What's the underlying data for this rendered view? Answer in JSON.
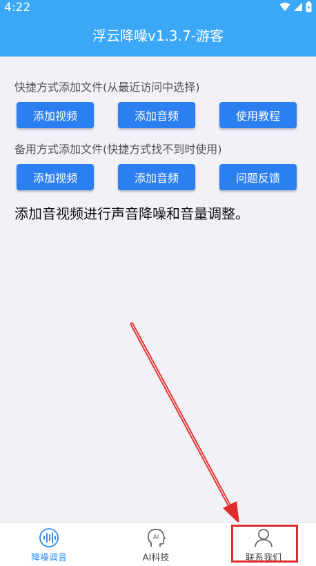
{
  "status_bar": {
    "time": "4:22"
  },
  "header": {
    "title": "浮云降噪v1.3.7-游客"
  },
  "sections": {
    "quick": {
      "label": "快捷方式添加文件(从最近访问中选择)",
      "buttons": [
        "添加视频",
        "添加音频",
        "使用教程"
      ]
    },
    "backup": {
      "label": "备用方式添加文件(快捷方式找不到时使用)",
      "buttons": [
        "添加视频",
        "添加音频",
        "问题反馈"
      ]
    }
  },
  "description": "添加音视频进行声音降噪和音量调整。",
  "bottom_nav": {
    "items": [
      {
        "label": "降噪调音",
        "icon": "waveform-icon",
        "active": true
      },
      {
        "label": "AI科技",
        "icon": "ai-head-icon",
        "active": false
      },
      {
        "label": "联系我们",
        "icon": "person-icon",
        "active": false
      }
    ]
  },
  "colors": {
    "header_bg": "#3aa8f7",
    "button_bg": "#2b7ff0",
    "active_nav": "#2b8ff0",
    "annotation": "#e02b2b"
  }
}
